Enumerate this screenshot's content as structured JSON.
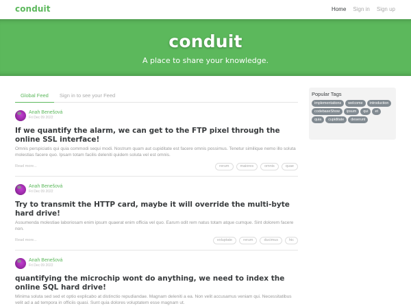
{
  "nav": {
    "brand": "conduit",
    "links": [
      "Home",
      "Sign in",
      "Sign up"
    ]
  },
  "banner": {
    "title": "conduit",
    "subtitle": "A place to share your knowledge."
  },
  "feed": {
    "tabs": [
      "Global Feed",
      "Sign in to see your Feed"
    ],
    "articles": [
      {
        "author": "Anah Benešová",
        "date": "Fri Dec 09 2022",
        "title": "If we quantify the alarm, we can get to the FTP pixel through the online SSL interface!",
        "description": "Omnis perspiciatis qui quia commodi sequi modi. Nostrum quam aut cupiditate est facere omnis possimus. Tenetur similique nemo illo soluta molestias facere quo. Ipsam totam facilis deleniti quidem soluta vel est omnis.",
        "read_more": "Read more...",
        "tags": [
          "rerum",
          "maiores",
          "omnis",
          "quae"
        ]
      },
      {
        "author": "Anah Benešová",
        "date": "Fri Dec 09 2022",
        "title": "Try to transmit the HTTP card, maybe it will override the multi-byte hard drive!",
        "description": "Assumenda molestiae laboriosam enim ipsum quaerat enim officia vel quo. Earum odit rem natus totam atque cumque. Sint dolorem facere non.",
        "read_more": "Read more...",
        "tags": [
          "voluptate",
          "rerum",
          "ducimus",
          "hic"
        ]
      },
      {
        "author": "Anah Benešová",
        "date": "Fri Dec 09 2022",
        "title": "quantifying the microchip wont do anything, we need to index the online SQL hard drive!",
        "description": "Minima soluta sed sed et optio explicabo at distinctio repudiandae. Magnam deleniti a ea. Non velit accusamus veniam qui. Necessitatibus velit ad a ad tempora in officiis quasi. Sunt quia dolores voluptatem esse magnam ut.",
        "read_more": "Read more...",
        "tags": []
      }
    ]
  },
  "sidebar": {
    "heading": "Popular Tags",
    "tags": [
      "implementations",
      "welcome",
      "introduction",
      "codebaseShow",
      "ipsum",
      "qui",
      "et",
      "quia",
      "cupiditate",
      "deserunt"
    ]
  },
  "colors": {
    "brand_green": "#5cb85c",
    "tag_pill": "#818a91"
  },
  "icons": {
    "avatar": "author-avatar-image"
  }
}
